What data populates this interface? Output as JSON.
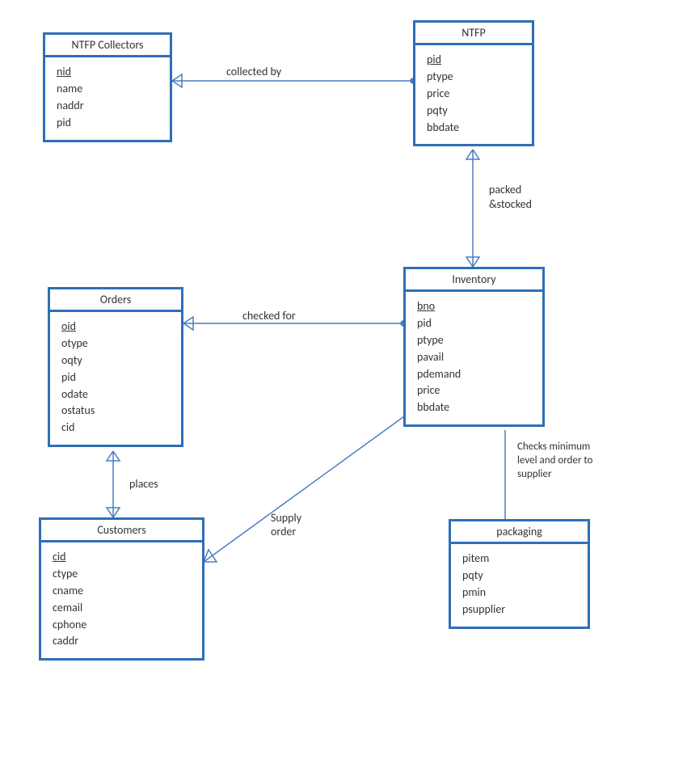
{
  "entities": {
    "ntfp_collectors": {
      "title": "NTFP Collectors",
      "attrs": [
        {
          "name": "nid",
          "key": true
        },
        {
          "name": "name",
          "key": false
        },
        {
          "name": "naddr",
          "key": false
        },
        {
          "name": "pid",
          "key": false
        }
      ]
    },
    "ntfp": {
      "title": "NTFP",
      "attrs": [
        {
          "name": "pid",
          "key": true
        },
        {
          "name": "ptype",
          "key": false
        },
        {
          "name": "price",
          "key": false
        },
        {
          "name": "pqty",
          "key": false
        },
        {
          "name": "bbdate",
          "key": false
        }
      ]
    },
    "orders": {
      "title": "Orders",
      "attrs": [
        {
          "name": "oid",
          "key": true
        },
        {
          "name": "otype",
          "key": false
        },
        {
          "name": "oqty",
          "key": false
        },
        {
          "name": "pid",
          "key": false
        },
        {
          "name": "odate",
          "key": false
        },
        {
          "name": "ostatus",
          "key": false
        },
        {
          "name": "cid",
          "key": false
        }
      ]
    },
    "inventory": {
      "title": "Inventory",
      "attrs": [
        {
          "name": "bno",
          "key": true
        },
        {
          "name": "pid",
          "key": false
        },
        {
          "name": "ptype",
          "key": false
        },
        {
          "name": "pavail",
          "key": false
        },
        {
          "name": "pdemand",
          "key": false
        },
        {
          "name": "price",
          "key": false
        },
        {
          "name": "bbdate",
          "key": false
        }
      ]
    },
    "customers": {
      "title": "Customers",
      "attrs": [
        {
          "name": "cid",
          "key": true
        },
        {
          "name": "ctype",
          "key": false
        },
        {
          "name": "cname",
          "key": false
        },
        {
          "name": "cemail",
          "key": false
        },
        {
          "name": "cphone",
          "key": false
        },
        {
          "name": "caddr",
          "key": false
        }
      ]
    },
    "packaging": {
      "title": "packaging",
      "attrs": [
        {
          "name": "pitem",
          "key": false
        },
        {
          "name": "pqty",
          "key": false
        },
        {
          "name": "pmin",
          "key": false
        },
        {
          "name": "psupplier",
          "key": false
        }
      ]
    }
  },
  "relations": {
    "collected_by": "collected by",
    "packed_stocked_line1": "packed",
    "packed_stocked_line2": "&stocked",
    "checked_for": "checked for",
    "places": "places",
    "supply_order": "Supply\norder",
    "checks_min_line1": "Checks minimum",
    "checks_min_line2": "level and order to",
    "checks_min_line3": "supplier"
  }
}
